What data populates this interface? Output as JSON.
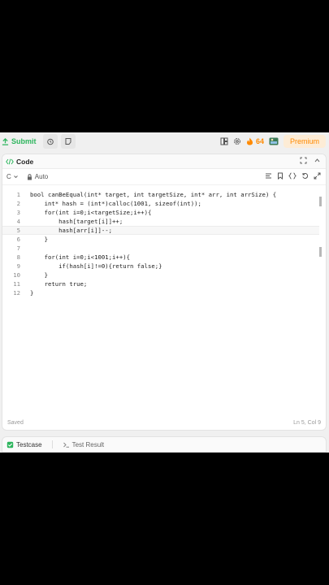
{
  "toolbar": {
    "submit_label": "Submit",
    "streak_count": "64",
    "premium_label": "Premium"
  },
  "code_panel": {
    "title": "Code",
    "language": "C",
    "mode": "Auto"
  },
  "editor": {
    "lines": [
      {
        "n": "1",
        "text": "bool canBeEqual(int* target, int targetSize, int* arr, int arrSize) {"
      },
      {
        "n": "2",
        "text": "    int* hash = (int*)calloc(1001, sizeof(int));"
      },
      {
        "n": "3",
        "text": "    for(int i=0;i<targetSize;i++){"
      },
      {
        "n": "4",
        "text": "        hash[target[i]]++;"
      },
      {
        "n": "5",
        "text": "        hash[arr[i]]--;"
      },
      {
        "n": "6",
        "text": "    }"
      },
      {
        "n": "7",
        "text": ""
      },
      {
        "n": "8",
        "text": "    for(int i=0;i<1001;i++){"
      },
      {
        "n": "9",
        "text": "        if(hash[i]!=0){return false;}"
      },
      {
        "n": "10",
        "text": "    }"
      },
      {
        "n": "11",
        "text": "    return true;"
      },
      {
        "n": "12",
        "text": "}"
      }
    ],
    "status_left": "Saved",
    "status_right": "Ln 5, Col 9"
  },
  "bottom_tabs": {
    "testcase_label": "Testcase",
    "result_label": "Test Result"
  },
  "colors": {
    "submit": "#2db55d",
    "premium": "#ff8a00",
    "keyword": "#0000ff"
  }
}
